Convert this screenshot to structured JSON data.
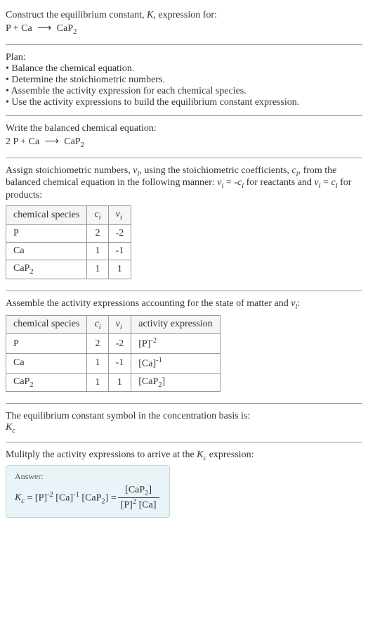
{
  "intro": {
    "line1": "Construct the equilibrium constant, K, expression for:",
    "equation": "P + Ca ⟶ CaP₂"
  },
  "plan": {
    "heading": "Plan:",
    "items": [
      "Balance the chemical equation.",
      "Determine the stoichiometric numbers.",
      "Assemble the activity expression for each chemical species.",
      "Use the activity expressions to build the equilibrium constant expression."
    ]
  },
  "balanced": {
    "heading": "Write the balanced chemical equation:",
    "equation": "2 P + Ca ⟶ CaP₂"
  },
  "stoich": {
    "text1": "Assign stoichiometric numbers, νᵢ, using the stoichiometric coefficients, cᵢ, from the balanced chemical equation in the following manner: νᵢ = -cᵢ for reactants and νᵢ = cᵢ for products:",
    "headers": [
      "chemical species",
      "cᵢ",
      "νᵢ"
    ],
    "rows": [
      {
        "species": "P",
        "c": "2",
        "v": "-2"
      },
      {
        "species": "Ca",
        "c": "1",
        "v": "-1"
      },
      {
        "species": "CaP₂",
        "c": "1",
        "v": "1"
      }
    ]
  },
  "activity": {
    "heading": "Assemble the activity expressions accounting for the state of matter and νᵢ:",
    "headers": [
      "chemical species",
      "cᵢ",
      "νᵢ",
      "activity expression"
    ],
    "rows": [
      {
        "species": "P",
        "c": "2",
        "v": "-2",
        "expr": "[P]⁻²"
      },
      {
        "species": "Ca",
        "c": "1",
        "v": "-1",
        "expr": "[Ca]⁻¹"
      },
      {
        "species": "CaP₂",
        "c": "1",
        "v": "1",
        "expr": "[CaP₂]"
      }
    ]
  },
  "symbol": {
    "heading": "The equilibrium constant symbol in the concentration basis is:",
    "value": "K_c"
  },
  "multiply": {
    "heading": "Mulitply the activity expressions to arrive at the K_c expression:"
  },
  "answer": {
    "label": "Answer:",
    "lhs": "K_c = [P]⁻² [Ca]⁻¹ [CaP₂] =",
    "num": "[CaP₂]",
    "den": "[P]² [Ca]"
  },
  "chart_data": {
    "type": "table",
    "tables": [
      {
        "title": "Stoichiometric numbers",
        "columns": [
          "chemical species",
          "c_i",
          "ν_i"
        ],
        "rows": [
          [
            "P",
            2,
            -2
          ],
          [
            "Ca",
            1,
            -1
          ],
          [
            "CaP2",
            1,
            1
          ]
        ]
      },
      {
        "title": "Activity expressions",
        "columns": [
          "chemical species",
          "c_i",
          "ν_i",
          "activity expression"
        ],
        "rows": [
          [
            "P",
            2,
            -2,
            "[P]^-2"
          ],
          [
            "Ca",
            1,
            -1,
            "[Ca]^-1"
          ],
          [
            "CaP2",
            1,
            1,
            "[CaP2]"
          ]
        ]
      }
    ],
    "equilibrium_expression": "K_c = [CaP2] / ([P]^2 [Ca])"
  }
}
